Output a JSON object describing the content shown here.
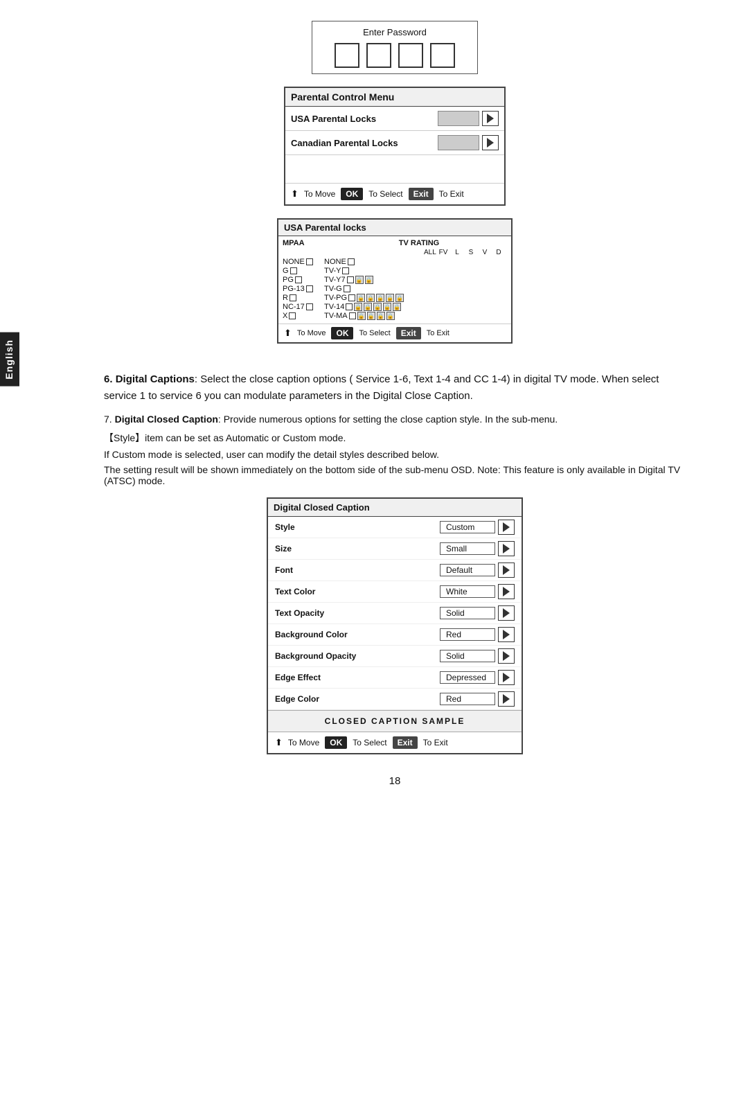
{
  "english_tab": "English",
  "password_section": {
    "title": "Enter  Password",
    "squares": [
      "",
      "",
      "",
      ""
    ]
  },
  "parental_menu": {
    "title": "Parental Control Menu",
    "rows": [
      {
        "label": "USA Parental Locks"
      },
      {
        "label": "Canadian Parental Locks"
      }
    ],
    "footer": {
      "move": "To Move",
      "select": "To Select",
      "exit": "To Exit"
    }
  },
  "usa_locks": {
    "title": "USA Parental locks",
    "mpaa_label": "MPAA",
    "tv_label": "TV RATING",
    "subheaders": [
      "ALL",
      "FV",
      "L",
      "S",
      "V",
      "D"
    ],
    "rows": [
      {
        "mpaa": "NONE",
        "tv": "NONE"
      },
      {
        "mpaa": "G",
        "tv": "TV-Y"
      },
      {
        "mpaa": "PG",
        "tv": "TV-Y7",
        "tv_locks": [
          true,
          true
        ]
      },
      {
        "mpaa": "PG-13",
        "tv": "TV-G"
      },
      {
        "mpaa": "R",
        "tv": "TV-PG",
        "tv_locks": [
          true,
          true,
          true,
          true,
          true
        ]
      },
      {
        "mpaa": "NC-17",
        "tv": "TV-14",
        "tv_locks": [
          true,
          true,
          true,
          true,
          true
        ]
      },
      {
        "mpaa": "X",
        "tv": "TV-MA",
        "tv_locks": [
          true,
          true,
          true,
          true
        ]
      }
    ],
    "footer": {
      "move": "To Move",
      "select": "To Select",
      "exit": "To Exit"
    }
  },
  "section6": {
    "number": "6.",
    "title": "Digital Captions",
    "text1": ": Select the close caption options ( Service 1-6, Text 1-4 and CC 1-4)  in digital TV mode. When select service 1 to service 6 you can modulate parameters in the Digital Close Caption."
  },
  "section7": {
    "number": "7.",
    "title": "Digital Closed Caption",
    "text1": ": Provide numerous options for setting the close caption style. In the sub-menu.",
    "style_note": "【Style】item can be set as Automatic or Custom mode.",
    "custom_note": "If Custom mode is selected, user can modify the detail styles described below.",
    "setting_note": "The setting result will be shown immediately on the bottom side of the sub-menu OSD. Note: This feature is only available in Digital TV (ATSC) mode."
  },
  "dcc_menu": {
    "title": "Digital Closed Caption",
    "rows": [
      {
        "label": "Style",
        "value": "Custom"
      },
      {
        "label": "Size",
        "value": "Small"
      },
      {
        "label": "Font",
        "value": "Default"
      },
      {
        "label": "Text Color",
        "value": "White"
      },
      {
        "label": "Text Opacity",
        "value": "Solid"
      },
      {
        "label": "Background Color",
        "value": "Red"
      },
      {
        "label": "Background Opacity",
        "value": "Solid"
      },
      {
        "label": "Edge Effect",
        "value": "Depressed"
      },
      {
        "label": "Edge Color",
        "value": "Red"
      }
    ],
    "sample_label": "CLOSED CAPTION SAMPLE",
    "footer": {
      "move": "To Move",
      "select": "To Select",
      "exit": "To Exit"
    }
  },
  "page_number": "18"
}
